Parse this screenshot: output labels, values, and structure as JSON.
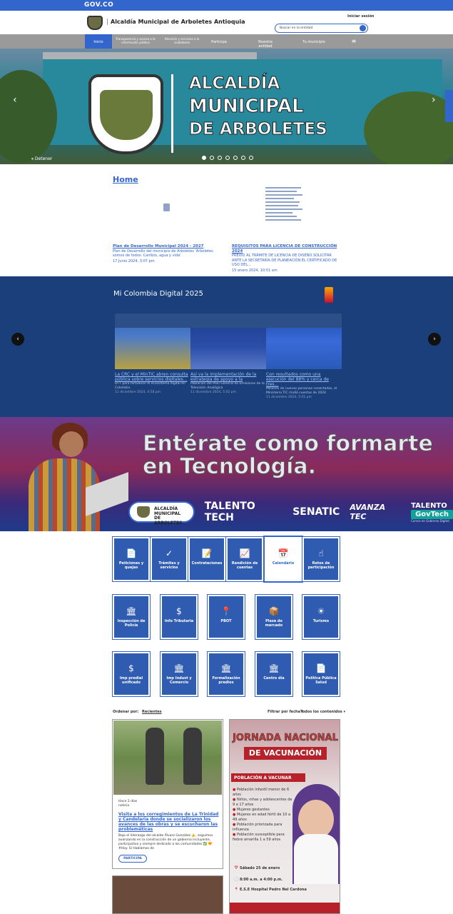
{
  "gov_bar": {
    "label": "GOV.CO"
  },
  "header": {
    "site_name": "Alcaldía Municipal de Arboletes Antioquia",
    "login": "Iniciar sesión",
    "search_placeholder": "Buscar en la entidad"
  },
  "nav": {
    "items": [
      "Inicio",
      "Transparencia y acceso a la información pública",
      "Atención y servicios a la ciudadanía",
      "Participa",
      "Nuestra entidad",
      "Tu municipio",
      "≡"
    ]
  },
  "hero": {
    "title_lines": [
      "ALCALDÍA",
      "MUNICIPAL",
      "DE ARBOLETES"
    ],
    "pause_label": "Detener",
    "slides": 7,
    "active_slide": 1
  },
  "home": {
    "title": "Home",
    "news": [
      {
        "title": "Plan de Desarrollo Municipal 2024 - 2027",
        "summary": "Plan de Desarrollo del municipio de Arboletes 'Arboletes somos de todos: Cambio, agua y vida'",
        "date": "17 Junio 2024, 3:07 pm"
      },
      {
        "title": "REQUISITOS PARA LICENCIA DE CONSTRUCCIÓN 2024",
        "summary": "PREVIO AL TRÁMITE DE LICENCIA DE DISEÑO SOLICITAR ANTE LA SECRETARÍA DE PLANEACIÓN EL CERTIFICADO DE USO DEL...",
        "date": "15 enero 2024, 10:51 am"
      }
    ]
  },
  "mi_colombia": {
    "title": "Mi Colombia Digital 2025",
    "cards": [
      {
        "title": "La CRC y el MinTIC abren consulta pública sobre servicios digitales...",
        "summary": "DTT para fortalecer el ecosistema digital en Colombia",
        "date": "11 diciembre 2024, 4:58 pm"
      },
      {
        "title": "Así va la implementación de la estrategia de apoyo a la",
        "summary": "Población del Plan General de Emisiones de la Televisión Analógica",
        "date": "11 diciembre 2024, 5:02 pm"
      },
      {
        "title": "Con resultados como una ejecución del 88% y cerca de tres...",
        "summary": "Millones de nuevas personas conectadas, el Ministerio TIC rindió cuentas de 2024",
        "date": "11 diciembre 2024, 5:01 pm"
      }
    ]
  },
  "banner": {
    "headline_1": "Entérate como formarte",
    "headline_2": "en Tecnología.",
    "pill_text": "ALCALDÍA MUNICIPAL DE ARBOLETES",
    "logos": [
      "TALENTO TECH",
      "SENATIC",
      "AVANZA TEC",
      "TALENTO",
      "GovTech",
      "Cursos en Gobierno Digital"
    ]
  },
  "tiles_row1": [
    {
      "label": "Peticiones y quejas",
      "icon": "📄"
    },
    {
      "label": "Trámites y servicios",
      "icon": "✓"
    },
    {
      "label": "Contrataciones",
      "icon": "📝"
    },
    {
      "label": "Rendición de cuentas",
      "icon": "📈"
    },
    {
      "label": "Calendario",
      "icon": "📅"
    },
    {
      "label": "Retos de participación",
      "icon": "☝"
    }
  ],
  "tiles_row2": [
    {
      "label": "Inspección de Policía",
      "icon": "🏛"
    },
    {
      "label": "Info Tributaria",
      "icon": "$"
    },
    {
      "label": "PBOT",
      "icon": "📍"
    },
    {
      "label": "Plaza de mercado",
      "icon": "📦"
    },
    {
      "label": "Turismo",
      "icon": "☀"
    }
  ],
  "tiles_row3": [
    {
      "label": "Imp predial unificado",
      "icon": "$"
    },
    {
      "label": "Imp Indust y Comercio",
      "icon": "🏛"
    },
    {
      "label": "Formalización predios",
      "icon": "🏛"
    },
    {
      "label": "Centro día",
      "icon": "🏛"
    },
    {
      "label": "Política Pública Salud",
      "icon": "📄"
    }
  ],
  "filter": {
    "order_label": "Ordenar por:",
    "order_value": "Recientes",
    "by_date": "Filtrar por fecha ▾",
    "all_content": "Todos los contenidos ▾"
  },
  "post": {
    "meta": "Hace 2 días",
    "category": "noticia",
    "title": "Visita a los corregimientos de La Trinidad y Candelaria donde se socializaron los avances de las obras y se escucharon las problemáticas",
    "excerpt": "Bajo el liderazgo del alcalde Álvaro González 👍, seguimos avanzando en la construcción de un gobierno incluyente, participativo y siempre dedicado a las comunidades ✅ 🧡 #Hoy. Sí Hablamos de",
    "button": "PARTICIPA"
  },
  "poster": {
    "line1": "JORNADA NACIONAL",
    "line2": "DE VACUNACIÓN",
    "section": "POBLACIÓN A VACUNAR",
    "items": [
      "Población infantil menor de 6 años",
      "Niños, niñas y adolescentes de 9 a 17 años",
      "Mujeres gestantes",
      "Mujeres en edad fértil de 10 a 49 años",
      "Población priorizada para influenza",
      "Población susceptible para fiebre amarilla 1 a 59 años"
    ],
    "date": "Sábado 25 de enero",
    "time": "8:00 a.m. a 4:00 p.m.",
    "place": "E.S.E Hospital Pedro Nel Cardona"
  }
}
